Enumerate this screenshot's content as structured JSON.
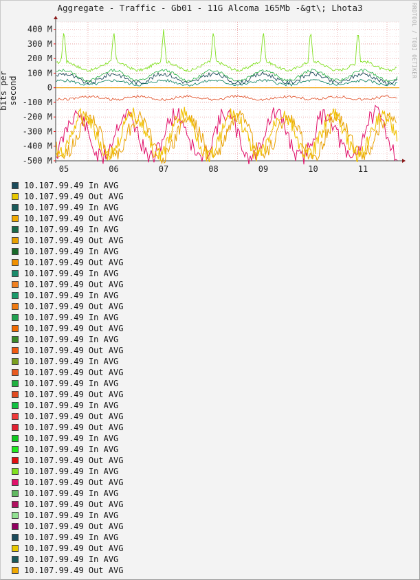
{
  "chart_data": {
    "type": "line",
    "title": "Aggregate - Traffic - Gb01 - 11G Alcoma 165Mb -&gt\\; Lhota3",
    "ylabel": "bits per second",
    "xlabel": "",
    "x_ticks": [
      "05",
      "06",
      "07",
      "08",
      "09",
      "10",
      "11"
    ],
    "y_ticks": [
      "400 M",
      "300 M",
      "200 M",
      "100 M",
      "0",
      "-100 M",
      "-200 M",
      "-300 M",
      "-400 M",
      "-500 M"
    ],
    "ylim": [
      -500,
      450
    ],
    "grid": true,
    "series_approx": {
      "in_peak_green": {
        "baseline_M": 150,
        "peaks_M": [
          400,
          390,
          395,
          380,
          410,
          430,
          410
        ]
      },
      "in_dark": {
        "baseline_M": 50,
        "peak_M": 130
      },
      "out_orange_red": {
        "baseline_M": -60
      },
      "out_yellow": {
        "range_M": [
          -480,
          -100
        ]
      },
      "out_magenta": {
        "range_M": [
          -450,
          -150
        ]
      }
    }
  },
  "watermark": "RRDTOOL / TOBI OETIKER",
  "legend": [
    {
      "label": "10.107.99.49 In AVG",
      "color": "#1a4a5a"
    },
    {
      "label": "10.107.99.49 Out AVG",
      "color": "#e8c800"
    },
    {
      "label": "10.107.99.49 In AVG",
      "color": "#1a5a5a"
    },
    {
      "label": "10.107.99.49 Out AVG",
      "color": "#f0a800"
    },
    {
      "label": "10.107.99.49 In AVG",
      "color": "#1a6a4a"
    },
    {
      "label": "10.107.99.49 Out AVG",
      "color": "#e8a000"
    },
    {
      "label": "10.107.99.49 In AVG",
      "color": "#1a6a2a"
    },
    {
      "label": "10.107.99.49 Out AVG",
      "color": "#f09000"
    },
    {
      "label": "10.107.99.49 In AVG",
      "color": "#1a8a6a"
    },
    {
      "label": "10.107.99.49 Out AVG",
      "color": "#f08020"
    },
    {
      "label": "10.107.99.49 In AVG",
      "color": "#1a9a6a"
    },
    {
      "label": "10.107.99.49 Out AVG",
      "color": "#f07a10"
    },
    {
      "label": "10.107.99.49 In AVG",
      "color": "#20a050"
    },
    {
      "label": "10.107.99.49 Out AVG",
      "color": "#f06a00"
    },
    {
      "label": "10.107.99.49 In AVG",
      "color": "#3a8a2a"
    },
    {
      "label": "10.107.99.49 Out AVG",
      "color": "#f05a10"
    },
    {
      "label": "10.107.99.49 In AVG",
      "color": "#7aa020"
    },
    {
      "label": "10.107.99.49 Out AVG",
      "color": "#e85a20"
    },
    {
      "label": "10.107.99.49 In AVG",
      "color": "#20b040"
    },
    {
      "label": "10.107.99.49 Out AVG",
      "color": "#e04a20"
    },
    {
      "label": "10.107.99.49 In AVG",
      "color": "#10c040"
    },
    {
      "label": "10.107.99.49 Out AVG",
      "color": "#f03a3a"
    },
    {
      "label": "10.107.99.49 Out AVG",
      "color": "#e02030"
    },
    {
      "label": "10.107.99.49 In AVG",
      "color": "#10c820"
    },
    {
      "label": "10.107.99.49 In AVG",
      "color": "#20e820"
    },
    {
      "label": "10.107.99.49 Out AVG",
      "color": "#e01010"
    },
    {
      "label": "10.107.99.49 In AVG",
      "color": "#80e020"
    },
    {
      "label": "10.107.99.49 Out AVG",
      "color": "#e0106a"
    },
    {
      "label": "10.107.99.49 In AVG",
      "color": "#60b860"
    },
    {
      "label": "10.107.99.49 Out AVG",
      "color": "#b01060"
    },
    {
      "label": "10.107.99.49 In AVG",
      "color": "#90e090"
    },
    {
      "label": "10.107.99.49 Out AVG",
      "color": "#900060"
    },
    {
      "label": "10.107.99.49 In AVG",
      "color": "#1a4a5a"
    },
    {
      "label": "10.107.99.49 Out AVG",
      "color": "#e8c800"
    },
    {
      "label": "10.107.99.49 In AVG",
      "color": "#1a5a5a"
    },
    {
      "label": "10.107.99.49 Out AVG",
      "color": "#f0a800"
    }
  ]
}
